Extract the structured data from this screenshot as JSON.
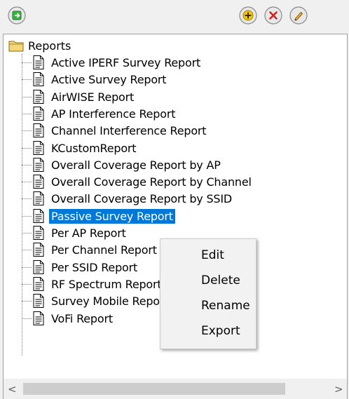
{
  "toolbar": {
    "nav_icon": "green-arrow-icon",
    "add_icon": "add-icon",
    "delete_icon": "delete-icon",
    "edit_icon": "pencil-icon"
  },
  "tree": {
    "root_label": "Reports",
    "items": [
      "Active IPERF Survey Report",
      "Active Survey Report",
      "AirWISE Report",
      "AP Interference Report",
      "Channel Interference Report",
      "KCustomReport",
      "Overall Coverage Report by AP",
      "Overall Coverage Report by Channel",
      "Overall Coverage Report by SSID",
      "Passive Survey Report",
      "Per AP Report",
      "Per Channel Report",
      "Per SSID Report",
      "RF Spectrum Report",
      "Survey Mobile Report",
      "VoFi Report"
    ],
    "selected_item": "Passive Survey Report"
  },
  "context_menu": {
    "items": [
      "Edit",
      "Delete",
      "Rename",
      "Export"
    ]
  },
  "scrollbar": {
    "left_arrow": "<",
    "right_arrow": ">"
  },
  "colors": {
    "selection": "#0078d7",
    "add": "#e8c000",
    "delete": "#d42020",
    "folder": "#f5d77a"
  }
}
